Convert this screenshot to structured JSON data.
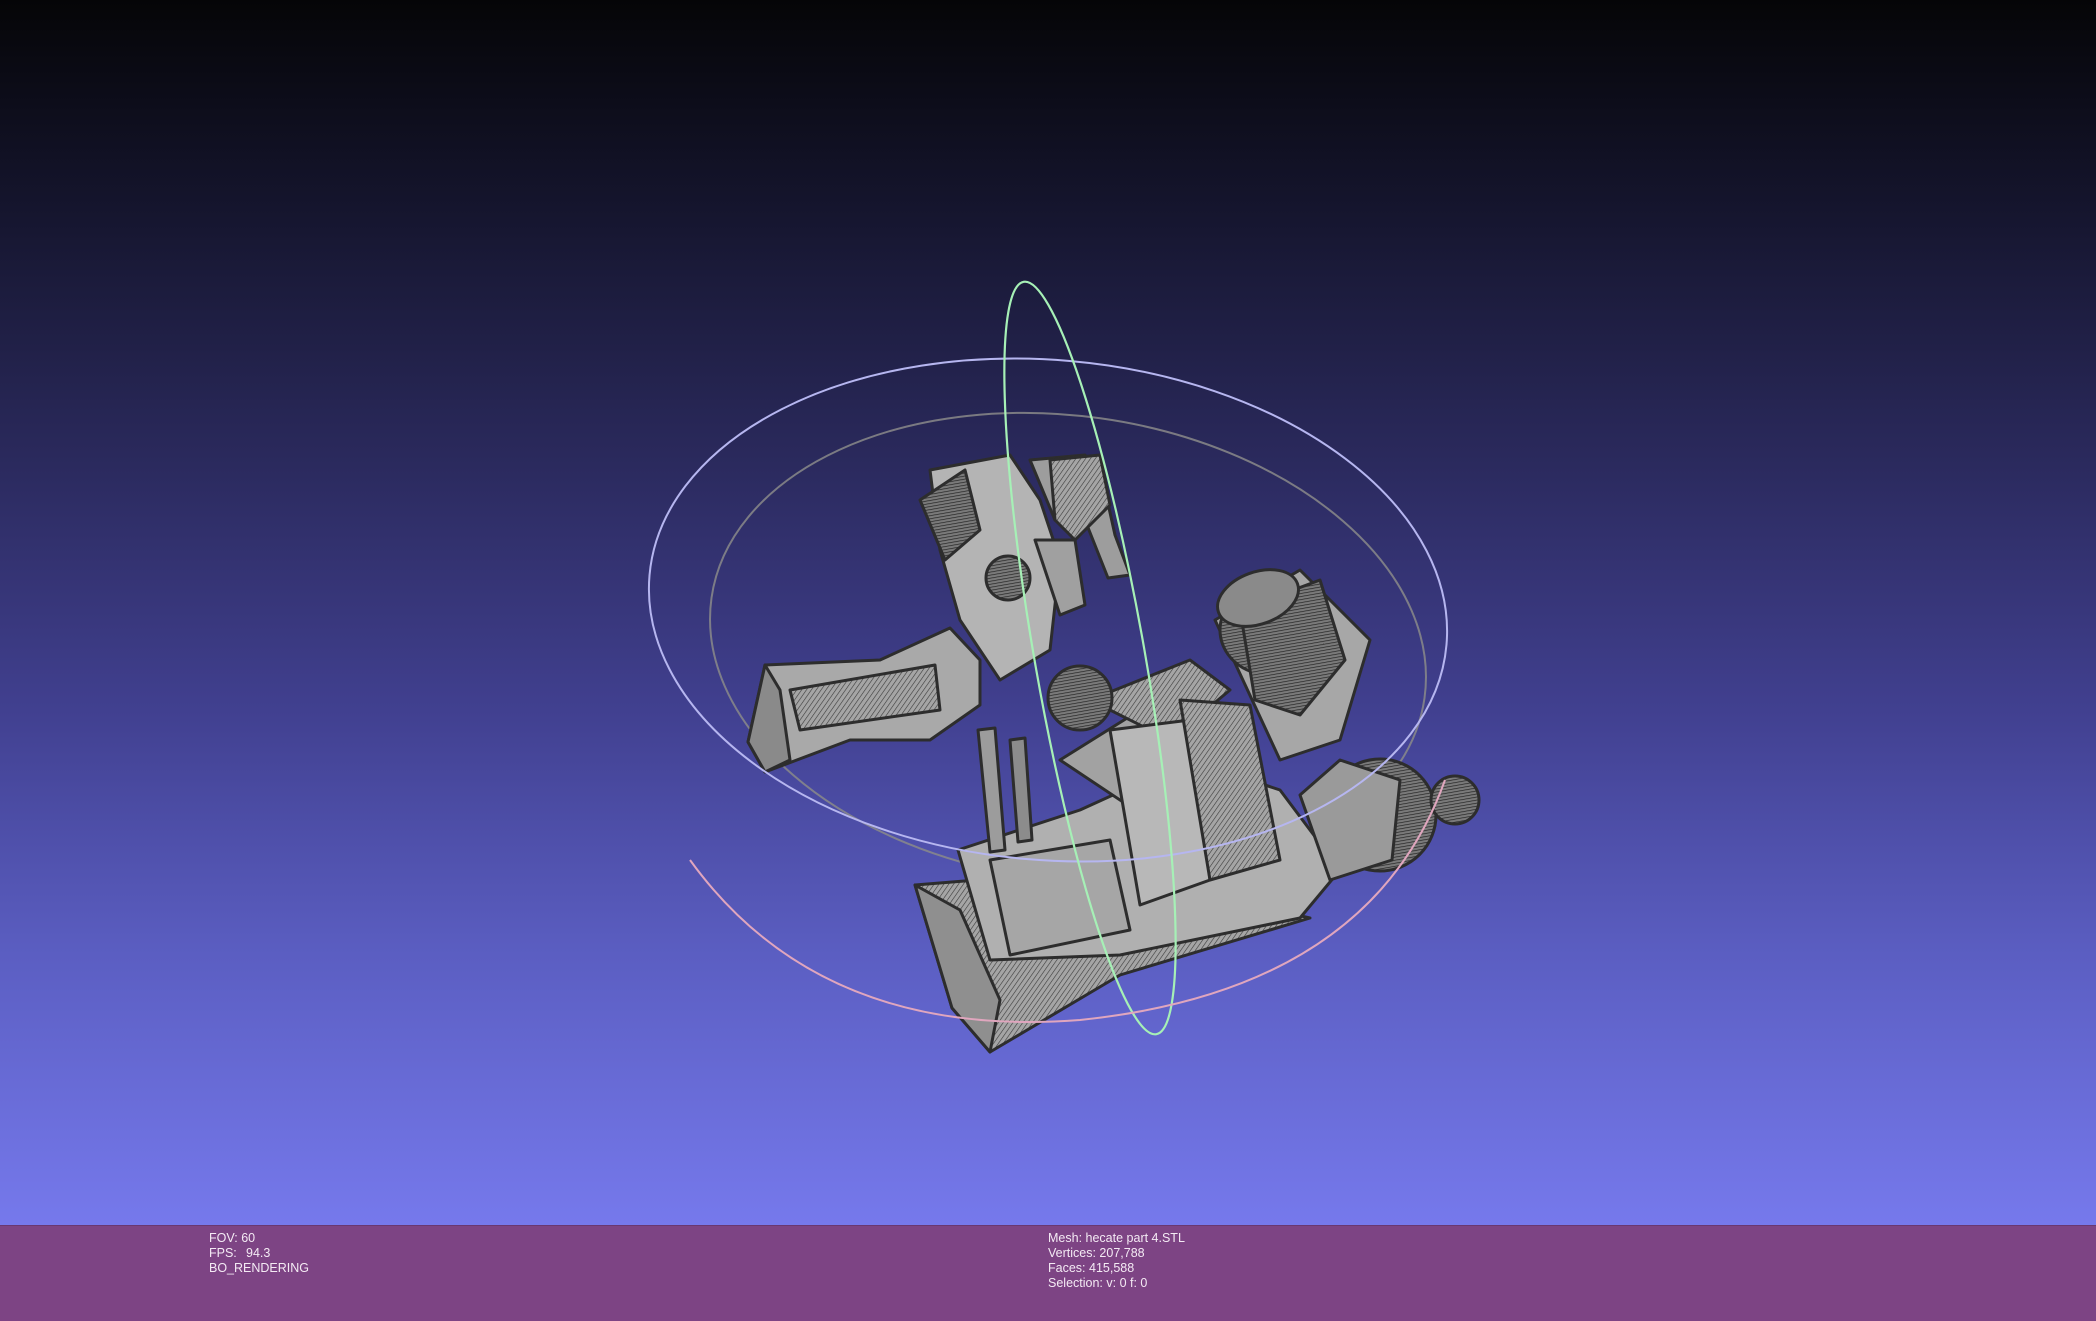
{
  "viewport": {
    "background_top": "#050507",
    "background_bottom": "#7679ec",
    "mesh_color": "#a8a8a8",
    "wire_color": "#2d2d2d",
    "trackball_colors": [
      "#9a9ae6",
      "#9aeca8",
      "#d49ab4",
      "#8a8a8a"
    ]
  },
  "status": {
    "left": {
      "fov_label": "FOV:",
      "fov_value": "60",
      "fps_label": "FPS:",
      "fps_value": "94.3",
      "render_mode": "BO_RENDERING"
    },
    "center": {
      "mesh_label": "Mesh:",
      "mesh_name": "hecate part 4.STL",
      "vertices_label": "Vertices:",
      "vertices_value": "207,788",
      "faces_label": "Faces:",
      "faces_value": "415,588",
      "selection_label": "Selection:",
      "selection_value": "v: 0 f: 0"
    },
    "bar_color": "#7d4484"
  }
}
